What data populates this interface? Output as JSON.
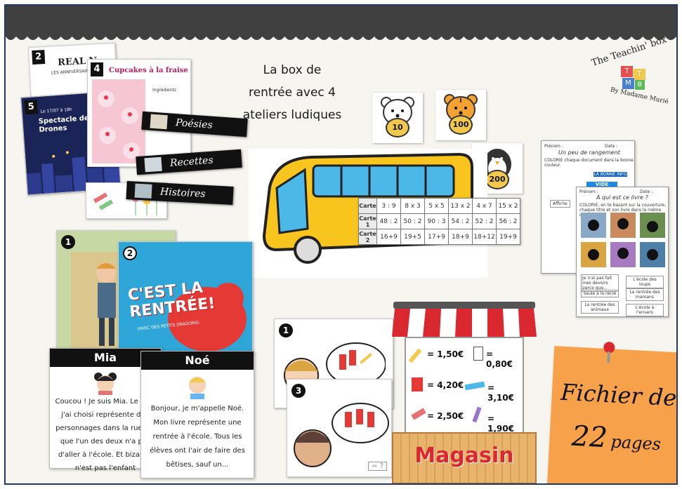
{
  "title": {
    "line1": "La box de",
    "line2": "rentrée avec 4",
    "line3": "ateliers ludiques"
  },
  "logo": {
    "name": "The Teachin' box",
    "tagline": "By Madame Murié",
    "letters": [
      "T",
      "T",
      "M",
      "B"
    ]
  },
  "docs": {
    "doc1": {
      "number": "2",
      "title": "REAL N",
      "subtitle": "LES ANNIVERSAIRE"
    },
    "doc2": {
      "number": "4",
      "title": "Cupcakes à la fraise",
      "subtitle": "Ingrédients"
    },
    "doc3": {
      "number": "5",
      "title": "Spectacle de Drones",
      "subtitle": "Le 17/07 à 18h"
    }
  },
  "category_labels": [
    "Poésies",
    "Recettes",
    "Histoires"
  ],
  "tokens": [
    "10",
    "100",
    "200"
  ],
  "calc_table": {
    "rows": [
      {
        "label": "Carte",
        "cells": [
          "3 : 9",
          "8 x 3",
          "5 x 5",
          "13 x 2",
          "4 x 7",
          "15 x 2"
        ]
      },
      {
        "label": "Carte 1",
        "cells": [
          "48 : 2",
          "50 : 2",
          "90 : 3",
          "54 : 2",
          "52 : 2",
          "56 : 2"
        ]
      },
      {
        "label": "Carte 2",
        "cells": [
          "16+9",
          "19+5",
          "17+9",
          "18+9",
          "18+12",
          "19+9"
        ]
      }
    ]
  },
  "worksheets": {
    "sheet1": {
      "title": "Un peu de rangement",
      "lines": [
        "Prénom :",
        "Date :",
        "COLORIE chaque document dans la bonne couleur.",
        "LA BONNE INFO",
        "VIDE GRENIER",
        "Affiche"
      ]
    },
    "sheet2": {
      "title": "À qui est ce livre ?",
      "lines": [
        "Prénom :",
        "Date :",
        "COLORIE, en te basant sur la couverture, chaque titre et son livre dans la même couleur."
      ],
      "options": [
        "Je n'ai pas fait mes devoirs parce que...",
        "L'école des loups",
        "Seule à la récré",
        "La rentrée des mamans",
        "La rentrée des animaux",
        "L'école à l'envers"
      ]
    }
  },
  "books": {
    "book1": {
      "number": "1"
    },
    "book2": {
      "number": "2",
      "title": "C'EST LA RENTRÉE!",
      "subtitle": "(AVEC DES PETITS DRAGONS)"
    }
  },
  "characters": [
    {
      "name": "Mia",
      "lines": [
        "Coucou ! Je suis Mia. Le livre",
        "j'ai choisi représente deu",
        "personnages dans la rue. Or",
        "que l'un des deux n'a pas",
        "d'aller à l'école. Et bizarrer",
        "n'est pas l'enfant"
      ]
    },
    {
      "name": "Noé",
      "lines": [
        "Bonjour, je m'appelle Noé.",
        "Mon livre représente une",
        "rentrée à l'école. Tous les",
        "élèves ont l'air de faire des",
        "bêtises, sauf un..."
      ]
    }
  ],
  "shopping_cards": [
    {
      "number": "1",
      "answer": "= ?"
    },
    {
      "number": "3",
      "answer": "= ?"
    }
  ],
  "shop": {
    "name": "Magasin",
    "prices": [
      "= 1,50€",
      "= 0,80€",
      "= 4,20€",
      "= 3,10€",
      "= 2,50€",
      "= 1,90€"
    ]
  },
  "sticky": {
    "line1": "Fichier de",
    "line2_number": "22",
    "line2_word": "pages"
  },
  "colors": {
    "frame": "#1f3864",
    "topbar": "#404040",
    "bus": "#f7c51d",
    "sticky": "#f7a24a",
    "awning_red": "#d9282f",
    "shop_sign": "#d9282f"
  }
}
